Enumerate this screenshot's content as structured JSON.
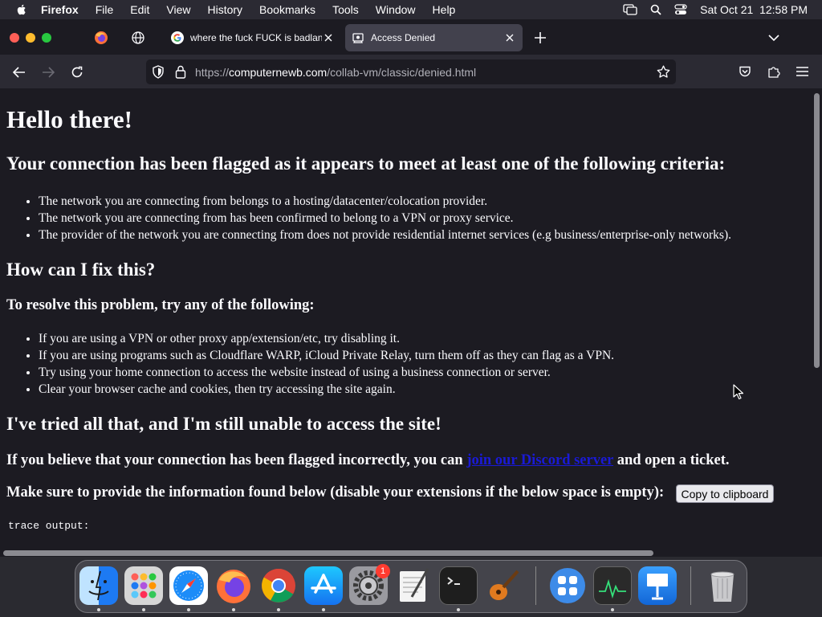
{
  "menubar": {
    "app": "Firefox",
    "items": [
      "File",
      "Edit",
      "View",
      "History",
      "Bookmarks",
      "Tools",
      "Window",
      "Help"
    ],
    "clock": "Sat Oct 21  12:58 PM"
  },
  "tabs": [
    {
      "title": "where the fuck FUCK is badlands",
      "favicon": "google-icon",
      "active": false
    },
    {
      "title": "Access Denied",
      "favicon": "collab-icon",
      "active": true
    }
  ],
  "address": {
    "scheme": "https://",
    "domain": "computernewb.com",
    "path": "/collab-vm/classic/denied.html"
  },
  "page": {
    "h1": "Hello there!",
    "flag_heading": "Your connection has been flagged as it appears to meet at least one of the following criteria:",
    "criteria": [
      "The network you are connecting from belongs to a hosting/datacenter/colocation provider.",
      "The network you are connecting from has been confirmed to belong to a VPN or proxy service.",
      "The provider of the network you are connecting from does not provide residential internet services (e.g business/enterprise-only networks)."
    ],
    "fix_heading": "How can I fix this?",
    "resolve_heading": "To resolve this problem, try any of the following:",
    "fixes": [
      "If you are using a VPN or other proxy app/extension/etc, try disabling it.",
      "If you are using programs such as Cloudflare WARP, iCloud Private Relay, turn them off as they can flag as a VPN.",
      "Try using your home connection to access the website instead of using a business connection or server.",
      "Clear your browser cache and cookies, then try accessing the site again."
    ],
    "tried_heading": "I've tried all that, and I'm still unable to access the site!",
    "incorrect_prefix": "If you believe that your connection has been flagged incorrectly, you can ",
    "discord_link": "join our Discord server",
    "incorrect_suffix": " and open a ticket.",
    "provide_text": "Make sure to provide the information found below (disable your extensions if the below space is empty):",
    "copy_button": "Copy to clipboard",
    "trace_label": "trace output:"
  },
  "dock": {
    "items": [
      "Finder",
      "Launchpad",
      "Safari",
      "Firefox",
      "Google Chrome",
      "App Store",
      "System Settings",
      "TextEdit",
      "Terminal",
      "GarageBand",
      "Mission Control",
      "Activity Monitor",
      "Keynote",
      "Trash"
    ],
    "settings_badge": "1"
  },
  "colors": {
    "page_bg": "#1c1b22",
    "toolbar_bg": "#2b2a33",
    "link": "#1a1ad6",
    "text": "#fbfbfe"
  }
}
